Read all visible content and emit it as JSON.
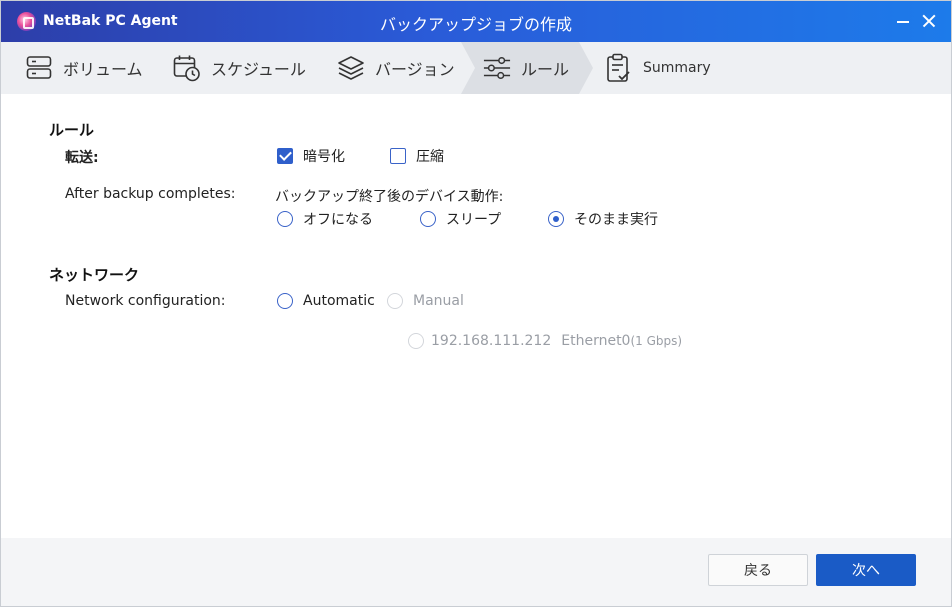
{
  "titlebar": {
    "app_name": "NetBak PC Agent",
    "window_title": "バックアップジョブの作成"
  },
  "steps": [
    {
      "label": "ボリューム",
      "icon": "server-icon"
    },
    {
      "label": "スケジュール",
      "icon": "calendar-clock-icon"
    },
    {
      "label": "バージョン",
      "icon": "layers-icon"
    },
    {
      "label": "ルール",
      "icon": "sliders-icon",
      "active": true
    },
    {
      "label": "Summary",
      "icon": "clipboard-check-icon"
    }
  ],
  "rules": {
    "section_title": "ルール",
    "transfer_label": "転送:",
    "encrypt_label": "暗号化",
    "encrypt_checked": true,
    "compress_label": "圧縮",
    "compress_checked": false,
    "after_backup_label": "After backup completes:",
    "after_backup_caption": "バックアップ終了後のデバイス動作:",
    "after_options": [
      "オフになる",
      "スリープ",
      "そのまま実行"
    ],
    "after_selected": "そのまま実行"
  },
  "network": {
    "section_title": "ネットワーク",
    "config_label": "Network configuration:",
    "automatic_label": "Automatic",
    "manual_label": "Manual",
    "ip": "192.168.111.212",
    "nic_name": "Ethernet0",
    "nic_speed": "(1 Gbps)"
  },
  "footer": {
    "back_label": "戻る",
    "next_label": "次へ"
  },
  "colors": {
    "accent": "#2f5fcb",
    "primary_button": "#1a5bc6",
    "titlebar_left": "#2d3ea9",
    "titlebar_right": "#1d7bea"
  }
}
